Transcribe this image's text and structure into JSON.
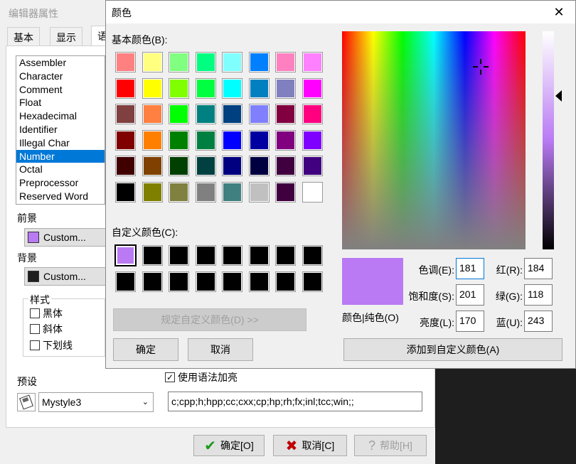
{
  "editor_window": {
    "title": "编辑器属性",
    "tabs": [
      "基本",
      "显示",
      "语"
    ],
    "token_list": [
      "Assembler",
      "Character",
      "Comment",
      "Float",
      "Hexadecimal",
      "Identifier",
      "Illegal Char",
      "Number",
      "Octal",
      "Preprocessor",
      "Reserved Word"
    ],
    "selected_token": "Number",
    "foreground_label": "前景",
    "foreground_value": "Custom...",
    "foreground_color": "#b97af3",
    "background_label": "背景",
    "background_value": "Custom...",
    "background_color": "#1e1e1e",
    "style_group_label": "样式",
    "style_bold": "黑体",
    "style_italic": "斜体",
    "style_underline": "下划线",
    "syntax_highlight_label": "使用语法加亮",
    "syntax_highlight_checked": "✓",
    "preset_label": "预设",
    "preset_value": "Mystyle3",
    "extensions": "c;cpp;h;hpp;cc;cxx;cp;hp;rh;fx;inl;tcc;win;;",
    "ok_button": "确定[O]",
    "cancel_button": "取消[C]",
    "help_button": "帮助[H]"
  },
  "color_dialog": {
    "title": "颜色",
    "close_glyph": "✕",
    "basic_colors_label": "基本颜色(B):",
    "basic_colors": [
      "#ff8080",
      "#ffff80",
      "#80ff80",
      "#00ff80",
      "#80ffff",
      "#0080ff",
      "#ff80c0",
      "#ff80ff",
      "#ff0000",
      "#ffff00",
      "#80ff00",
      "#00ff40",
      "#00ffff",
      "#0080c0",
      "#8080c0",
      "#ff00ff",
      "#804040",
      "#ff8040",
      "#00ff00",
      "#008080",
      "#004080",
      "#8080ff",
      "#800040",
      "#ff0080",
      "#800000",
      "#ff8000",
      "#008000",
      "#008040",
      "#0000ff",
      "#0000a0",
      "#800080",
      "#8000ff",
      "#400000",
      "#804000",
      "#004000",
      "#004040",
      "#000080",
      "#000040",
      "#400040",
      "#400080",
      "#000000",
      "#808000",
      "#808040",
      "#808080",
      "#408080",
      "#c0c0c0",
      "#400040",
      "#ffffff"
    ],
    "custom_colors_label": "自定义颜色(C):",
    "custom_colors": [
      "#b97af3",
      "#000000",
      "#000000",
      "#000000",
      "#000000",
      "#000000",
      "#000000",
      "#000000",
      "#000000",
      "#000000",
      "#000000",
      "#000000",
      "#000000",
      "#000000",
      "#000000",
      "#000000"
    ],
    "define_custom_button": "规定自定义颜色(D) >>",
    "ok_button": "确定",
    "cancel_button": "取消",
    "preview_label": "颜色|纯色(O)",
    "hue_label": "色调(E):",
    "hue_value": "181",
    "sat_label": "饱和度(S):",
    "sat_value": "201",
    "lum_label": "亮度(L):",
    "lum_value": "170",
    "red_label": "红(R):",
    "red_value": "184",
    "green_label": "绿(G):",
    "green_value": "118",
    "blue_label": "蓝(U):",
    "blue_value": "243",
    "add_custom_button": "添加到自定义颜色(A)",
    "current_color": "#b97af3"
  }
}
